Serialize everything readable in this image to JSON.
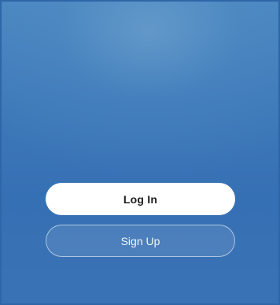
{
  "actions": {
    "login_label": "Log In",
    "signup_label": "Sign Up"
  },
  "colors": {
    "background": "#3d79b9",
    "login_button_bg": "#ffffff",
    "login_button_text": "#1d1d1f",
    "signup_button_border": "rgba(255,255,255,0.55)",
    "signup_button_text": "#ffffff"
  }
}
